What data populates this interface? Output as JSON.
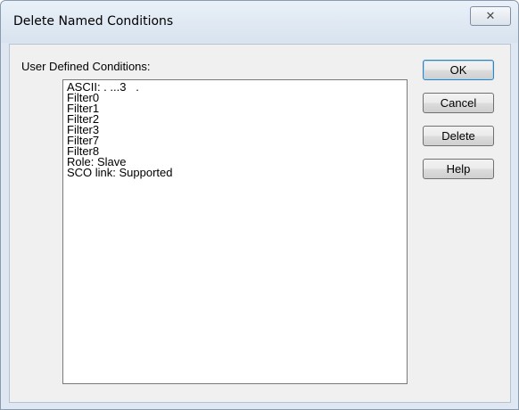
{
  "window": {
    "title": "Delete Named Conditions",
    "close_glyph": "✕",
    "close_icon": "close-icon"
  },
  "dialog": {
    "list_label": "User Defined Conditions:",
    "conditions": [
      "ASCII: . ...3   .",
      "Filter0",
      "Filter1",
      "Filter2",
      "Filter3",
      "Filter7",
      "Filter8",
      "Role: Slave",
      "SCO link: Supported"
    ]
  },
  "buttons": {
    "ok": "OK",
    "cancel": "Cancel",
    "delete": "Delete",
    "help": "Help"
  }
}
